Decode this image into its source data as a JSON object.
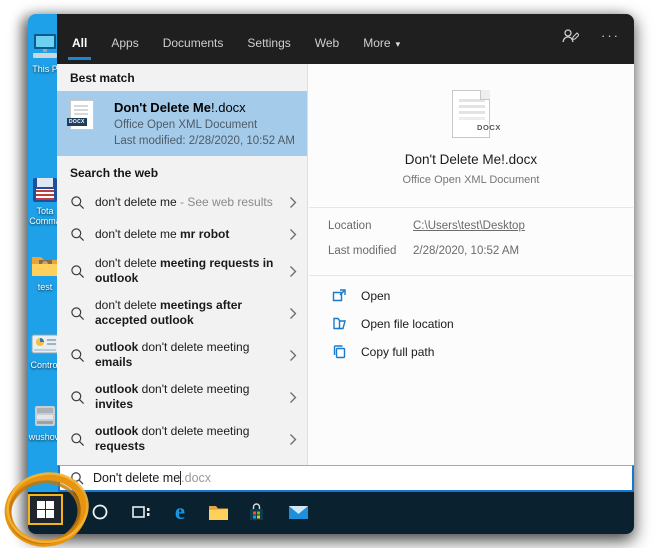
{
  "colors": {
    "desktop_blue": "#1ea1e8",
    "accent_blue": "#0078d7",
    "best_match_highlight": "#a5cbea",
    "taskbar_dark": "#0a2230",
    "annotation_orange": "#e8940f",
    "start_border_gold": "#f2b31c"
  },
  "desktop": {
    "icons": [
      {
        "label": "This P"
      },
      {
        "label": "Tota Comma"
      },
      {
        "label": "test"
      },
      {
        "label": "Control"
      },
      {
        "label": "wushow"
      }
    ]
  },
  "panel": {
    "tabs": [
      {
        "label": "All",
        "active": true
      },
      {
        "label": "Apps",
        "active": false
      },
      {
        "label": "Documents",
        "active": false
      },
      {
        "label": "Settings",
        "active": false
      },
      {
        "label": "Web",
        "active": false
      },
      {
        "label": "More",
        "active": false,
        "caret": "▾"
      }
    ],
    "ellipsis": "···",
    "best_match_header": "Best match",
    "best_match": {
      "title_bold": "Don't Delete Me",
      "title_rest": "!.docx",
      "subtitle": "Office Open XML Document",
      "last_modified": "Last modified: 2/28/2020, 10:52 AM",
      "file_badge": "DOCX"
    },
    "web_header": "Search the web",
    "suggestions": [
      {
        "segments": [
          {
            "text": "don't delete me",
            "bold": false
          },
          {
            "text": " - See web results",
            "bold": false,
            "muted": true
          }
        ]
      },
      {
        "segments": [
          {
            "text": "don't delete me ",
            "bold": false
          },
          {
            "text": "mr robot",
            "bold": true
          }
        ]
      },
      {
        "segments": [
          {
            "text": "don't delete ",
            "bold": false
          },
          {
            "text": "meeting requests in outlook",
            "bold": true
          }
        ]
      },
      {
        "segments": [
          {
            "text": "don't delete ",
            "bold": false
          },
          {
            "text": "meetings after accepted outlook",
            "bold": true
          }
        ]
      },
      {
        "segments": [
          {
            "text": "outlook ",
            "bold": true
          },
          {
            "text": "don't delete meeting ",
            "bold": false
          },
          {
            "text": "emails",
            "bold": true
          }
        ]
      },
      {
        "segments": [
          {
            "text": "outlook ",
            "bold": true
          },
          {
            "text": "don't delete meeting ",
            "bold": false
          },
          {
            "text": "invites",
            "bold": true
          }
        ]
      },
      {
        "segments": [
          {
            "text": "outlook ",
            "bold": true
          },
          {
            "text": "don't delete meeting ",
            "bold": false
          },
          {
            "text": "requests",
            "bold": true
          }
        ]
      }
    ],
    "preview": {
      "file_badge": "DOCX",
      "title": "Don't Delete Me!.docx",
      "subtitle": "Office Open XML Document",
      "location_label": "Location",
      "location_value": "C:\\Users\\test\\Desktop",
      "modified_label": "Last modified",
      "modified_value": "2/28/2020, 10:52 AM",
      "actions": [
        {
          "label": "Open",
          "icon": "open-icon"
        },
        {
          "label": "Open file location",
          "icon": "open-folder-icon"
        },
        {
          "label": "Copy full path",
          "icon": "copy-icon"
        }
      ]
    }
  },
  "search_box": {
    "typed": "Don't delete me",
    "suggestion": ".docx"
  }
}
